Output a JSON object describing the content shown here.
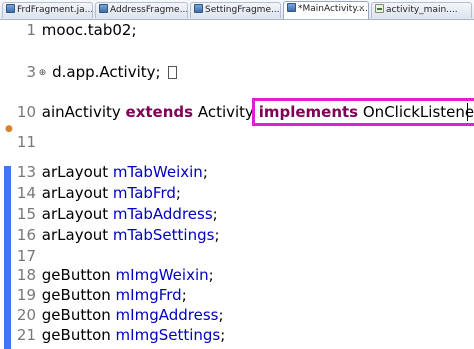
{
  "tabs": [
    {
      "label": "FrdFragment.ja...",
      "icon": "java-file-icon",
      "active": false
    },
    {
      "label": "AddressFragme...",
      "icon": "java-file-icon",
      "active": false
    },
    {
      "label": "SettingFragme...",
      "icon": "java-file-icon",
      "active": false
    },
    {
      "label": "*MainActivity....",
      "icon": "java-file-icon",
      "active": true
    },
    {
      "label": "activity_main....",
      "icon": "xml-file-icon",
      "active": false
    }
  ],
  "close_glyph": "✕",
  "colors": {
    "keyword": "#7f0055",
    "field": "#0000c0",
    "highlight_box": "#e020d0",
    "change_bar": "#3c78ef"
  },
  "lines": [
    {
      "num": "1",
      "text": "mooc.tab02;"
    },
    {
      "num": "3",
      "text": "d.app.Activity;"
    },
    {
      "num": "10",
      "pre": "ainActivity ",
      "kw1": "extends",
      "mid": " Activity ",
      "kw2": "implements",
      "post": " OnClickListener"
    },
    {
      "num": "11",
      "text": ""
    },
    {
      "num": "13",
      "type": "arLayout ",
      "field": "mTabWeixin",
      "end": ";"
    },
    {
      "num": "14",
      "type": "arLayout ",
      "field": "mTabFrd",
      "end": ";"
    },
    {
      "num": "15",
      "type": "arLayout ",
      "field": "mTabAddress",
      "end": ";"
    },
    {
      "num": "16",
      "type": "arLayout ",
      "field": "mTabSettings",
      "end": ";"
    },
    {
      "num": "17",
      "text": ""
    },
    {
      "num": "18",
      "type": "geButton ",
      "field": "mImgWeixin",
      "end": ";"
    },
    {
      "num": "19",
      "type": "geButton ",
      "field": "mImgFrd",
      "end": ";"
    },
    {
      "num": "20",
      "type": "geButton ",
      "field": "mImgAddress",
      "end": ";"
    },
    {
      "num": "21",
      "type": "geButton ",
      "field": "mImgSettings",
      "end": ";"
    }
  ],
  "fold_marker_glyph": "⊕"
}
